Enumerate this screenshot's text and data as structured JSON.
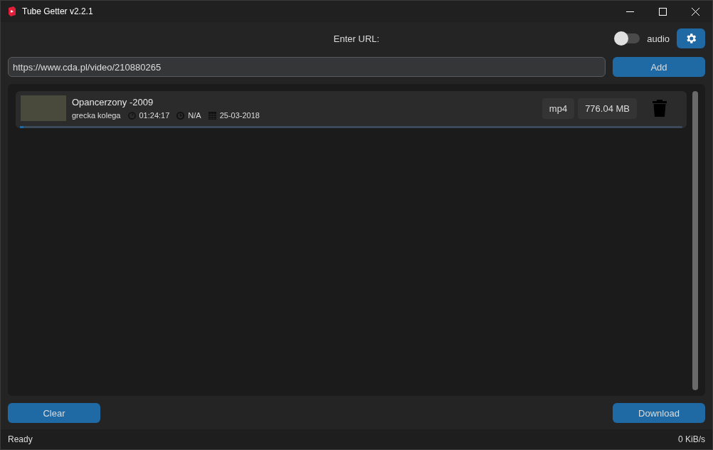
{
  "window": {
    "title": "Tube Getter v2.2.1"
  },
  "url_label": "Enter URL:",
  "audio_toggle": {
    "label": "audio",
    "on": false
  },
  "url_field": {
    "value": "https://www.cda.pl/video/210880265"
  },
  "add_button": "Add",
  "downloads": [
    {
      "title": "Opancerzony -2009",
      "author": "grecka kolega",
      "duration": "01:24:17",
      "time": "N/A",
      "date": "25-03-2018",
      "format": "mp4",
      "size": "776.04 MB",
      "level": 0.005
    }
  ],
  "clear_button": "Clear",
  "download_button": "Download",
  "status_bar": {
    "status": "Ready",
    "speed": "0 KiB/s"
  }
}
